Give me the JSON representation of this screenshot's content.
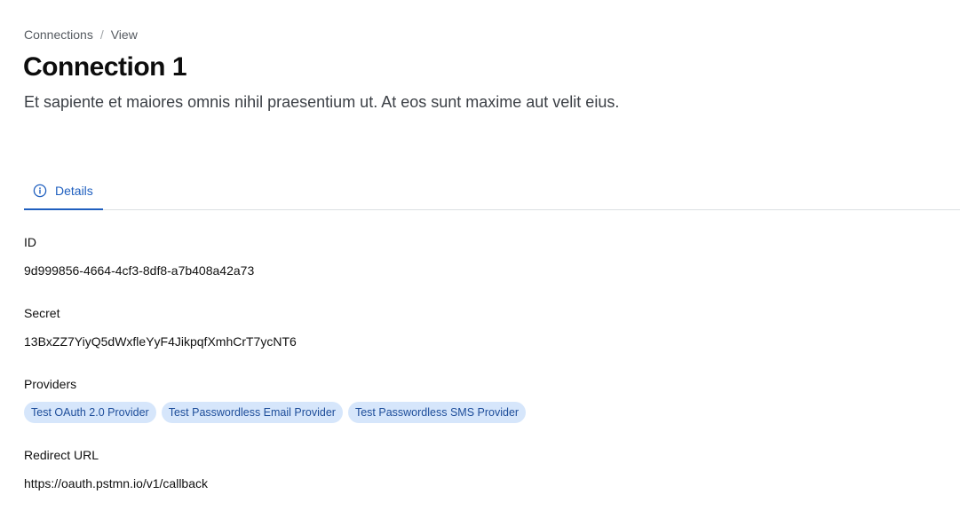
{
  "breadcrumb": {
    "items": [
      "Connections",
      "View"
    ],
    "separator": "/"
  },
  "page": {
    "title": "Connection 1",
    "description": "Et sapiente et maiores omnis nihil praesentium ut. At eos sunt maxime aut velit eius."
  },
  "tabs": [
    {
      "label": "Details",
      "icon": "info-circle-icon",
      "active": true
    }
  ],
  "fields": {
    "id": {
      "label": "ID",
      "value": "9d999856-4664-4cf3-8df8-a7b408a42a73"
    },
    "secret": {
      "label": "Secret",
      "value": "13BxZZ7YiyQ5dWxfleYyF4JikpqfXmhCrT7ycNT6"
    },
    "providers": {
      "label": "Providers",
      "items": [
        "Test OAuth 2.0 Provider",
        "Test Passwordless Email Provider",
        "Test Passwordless SMS Provider"
      ]
    },
    "redirect_url": {
      "label": "Redirect URL",
      "value": "https://oauth.pstmn.io/v1/callback"
    }
  },
  "colors": {
    "accent": "#1f5fbf",
    "chip_bg": "#d6e6fb",
    "chip_text": "#1d4d9a"
  }
}
